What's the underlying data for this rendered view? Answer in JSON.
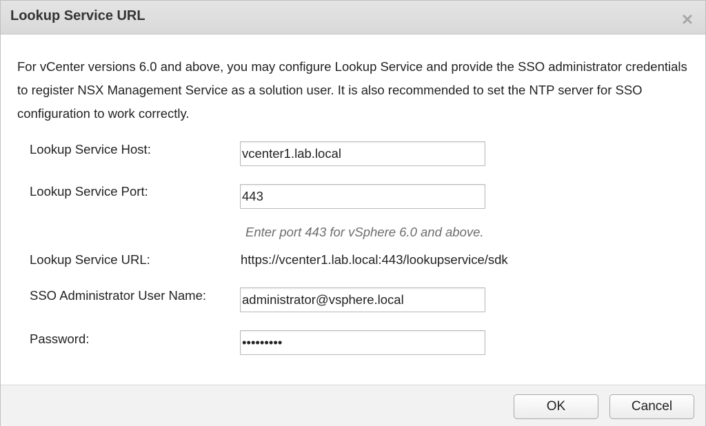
{
  "dialog": {
    "title": "Lookup Service URL",
    "close_icon": "close-icon",
    "intro_text": "For vCenter versions 6.0 and above, you may configure Lookup Service and provide the SSO administrator credentials to register NSX Management Service as a solution user. It is also recommended to set the NTP server for SSO configuration to work correctly."
  },
  "form": {
    "host": {
      "label": "Lookup Service Host:",
      "value": "vcenter1.lab.local"
    },
    "port": {
      "label": "Lookup Service Port:",
      "value": "443",
      "hint": "Enter port 443 for vSphere 6.0 and above."
    },
    "url": {
      "label": "Lookup Service URL:",
      "value": "https://vcenter1.lab.local:443/lookupservice/sdk"
    },
    "username": {
      "label": "SSO Administrator User Name:",
      "value": "administrator@vsphere.local"
    },
    "password": {
      "label": "Password:",
      "value": "•••••••••"
    }
  },
  "buttons": {
    "ok_label": "OK",
    "cancel_label": "Cancel"
  }
}
